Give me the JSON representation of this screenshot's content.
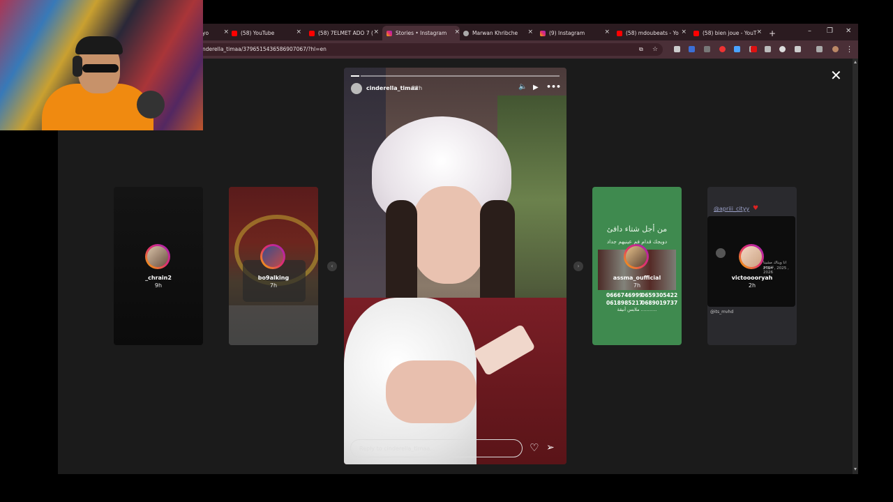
{
  "browser": {
    "tabs": [
      {
        "label": "yo",
        "favicon": "instagram-icon",
        "active": false
      },
      {
        "label": "(58) YouTube",
        "favicon": "youtube-icon",
        "active": false
      },
      {
        "label": "(58) 7ELMET ADO 7 (",
        "favicon": "youtube-icon",
        "active": false
      },
      {
        "label": "Stories • Instagram",
        "favicon": "instagram-icon",
        "active": true
      },
      {
        "label": "Marwan Khribche",
        "favicon": "avatar-icon",
        "active": false
      },
      {
        "label": "(9) Instagram",
        "favicon": "instagram-icon",
        "active": false
      },
      {
        "label": "(58) mdoubeats - Yo",
        "favicon": "youtube-icon",
        "active": false
      },
      {
        "label": "(58) bien joue - YouT",
        "favicon": "youtube-icon",
        "active": false
      }
    ],
    "new_tab_glyph": "+",
    "window_controls": {
      "minimize": "–",
      "restore": "❐",
      "close": "✕"
    },
    "url": "nderella_timaa/3796515436586907067/?hl=en",
    "accent": "#4a2f37"
  },
  "story_viewer": {
    "close_glyph": "✕",
    "main_story": {
      "username": "cinderella_timaa",
      "time": "22h",
      "reply_placeholder": "Reply to cinderella_timaa..."
    },
    "side_stories": [
      {
        "username": "_chrain2",
        "time": "9h"
      },
      {
        "username": "bo9alking",
        "time": "7h"
      },
      {
        "username": "assma_oufficial",
        "time": "7h",
        "overlay_title": "من أجل شتاء دافئ",
        "overlay_sub": "دويجك قدام فم عينيهم جداد",
        "phones_left": [
          "0666746999",
          "0618985217"
        ],
        "phones_right": [
          "0659305422",
          "0689019737"
        ],
        "overlay_foot": "ملابس أنيقة ..........."
      },
      {
        "username": "victooooryah",
        "time": "2h",
        "mention": "@apriii_cityy",
        "caption_small": "انا ويناك مشينا نتزوجو",
        "caption_years": "2024 , 2025 , 2026",
        "footer_handle": "@its_mvhd"
      }
    ]
  }
}
